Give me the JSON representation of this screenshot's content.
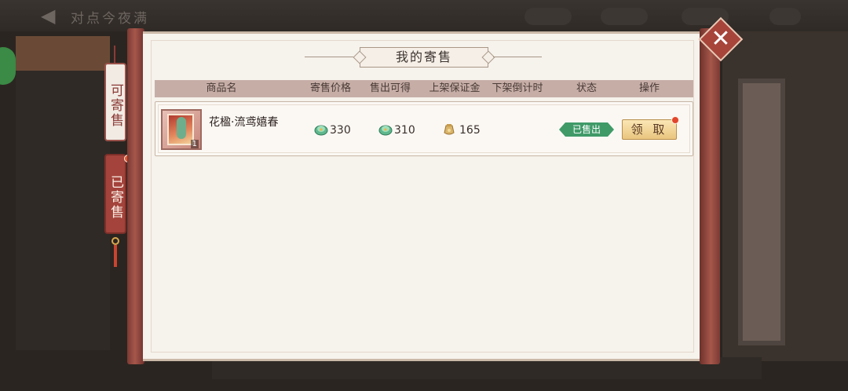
{
  "background": {
    "title": "对点今夜满",
    "back_icon": "back-arrow-icon"
  },
  "side_tabs": [
    {
      "label": "可寄售",
      "selected": false
    },
    {
      "label": "已寄售",
      "selected": true,
      "has_red_dot": true
    }
  ],
  "dialog": {
    "title": "我的寄售",
    "close_icon": "close-icon"
  },
  "table": {
    "columns": [
      "商品名",
      "寄售价格",
      "售出可得",
      "上架保证金",
      "下架倒计时",
      "状态",
      "操作"
    ],
    "rows": [
      {
        "item_name": "花楹·流鸢嬉春",
        "item_quantity": "1",
        "price_icon": "jade-coin-icon",
        "price": "330",
        "proceeds_icon": "jade-coin-icon",
        "proceeds": "310",
        "deposit_icon": "gold-pouch-icon",
        "deposit": "165",
        "countdown": "",
        "status": "已售出",
        "action_label": "领 取",
        "action_has_red_dot": true
      }
    ]
  },
  "colors": {
    "accent_red": "#a3433b",
    "status_green": "#3f9a68",
    "button_gold": "#e9c57e",
    "header_bar": "#c6aea7"
  }
}
